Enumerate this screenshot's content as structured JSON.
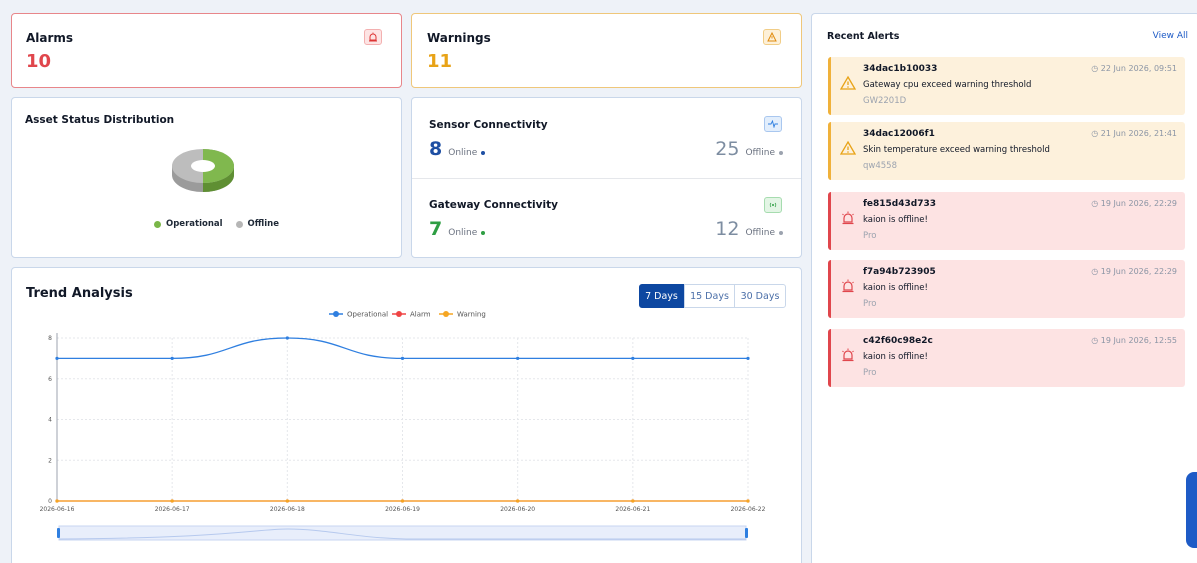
{
  "alarms": {
    "label": "Alarms",
    "value": "10",
    "color": "#e0464c",
    "icon": "siren-icon"
  },
  "warnings": {
    "label": "Warnings",
    "value": "11",
    "color": "#eab308",
    "icon": "warning-icon"
  },
  "asset_status": {
    "title": "Asset Status Distribution",
    "legend": [
      {
        "label": "Operational",
        "color": "#7ab648"
      },
      {
        "label": "Offline",
        "color": "#b6b6b6"
      }
    ]
  },
  "sensor": {
    "title": "Sensor Connectivity",
    "online": "8",
    "online_label": "Online",
    "offline": "25",
    "offline_label": "Offline",
    "icon": "activity-icon"
  },
  "gateway": {
    "title": "Gateway Connectivity",
    "online": "7",
    "online_label": "Online",
    "offline": "12",
    "offline_label": "Offline",
    "icon": "broadcast-icon"
  },
  "trend": {
    "title": "Trend Analysis",
    "ranges": [
      "7 Days",
      "15 Days",
      "30 Days"
    ],
    "active_range": "7 Days"
  },
  "chart_data": {
    "type": "line",
    "x": [
      "2026-06-16",
      "2026-06-17",
      "2026-06-18",
      "2026-06-19",
      "2026-06-20",
      "2026-06-21",
      "2026-06-22"
    ],
    "series": [
      {
        "name": "Operational",
        "values": [
          7,
          7,
          8,
          7,
          7,
          7,
          7
        ],
        "color": "#2f7fe0"
      },
      {
        "name": "Alarm",
        "values": [
          0,
          0,
          0,
          0,
          0,
          0,
          0
        ],
        "color": "#ef4444"
      },
      {
        "name": "Warning",
        "values": [
          0,
          0,
          0,
          0,
          0,
          0,
          0
        ],
        "color": "#f5a623"
      }
    ],
    "ylim": [
      0,
      8
    ],
    "yticks": [
      "0",
      "2",
      "4",
      "6",
      "8"
    ],
    "grid": true,
    "legend": "top-center"
  },
  "recent_alerts": {
    "title": "Recent Alerts",
    "view_all": "View All",
    "items": [
      {
        "id": "34dac1b10033",
        "message": "Gateway cpu exceed warning threshold",
        "source": "GW2201D",
        "time": "22 Jun 2026, 09:51",
        "level": "warning"
      },
      {
        "id": "34dac12006f1",
        "message": "Skin temperature exceed warning threshold",
        "source": "qw4558",
        "time": "21 Jun 2026, 21:41",
        "level": "warning"
      },
      {
        "id": "fe815d43d733",
        "message": "kaion is offline!",
        "source": "Pro",
        "time": "19 Jun 2026, 22:29",
        "level": "alarm"
      },
      {
        "id": "f7a94b723905",
        "message": "kaion is offline!",
        "source": "Pro",
        "time": "19 Jun 2026, 22:29",
        "level": "alarm"
      },
      {
        "id": "c42f60c98e2c",
        "message": "kaion is offline!",
        "source": "Pro",
        "time": "19 Jun 2026, 12:55",
        "level": "alarm"
      }
    ]
  }
}
